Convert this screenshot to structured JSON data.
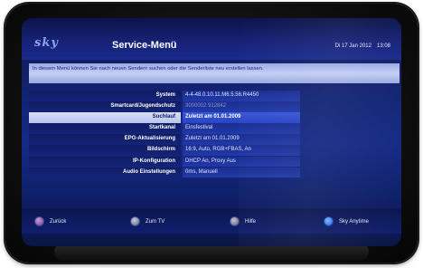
{
  "header": {
    "logo": "sky",
    "title": "Service-Menü",
    "date": "Di 17 Jan 2012",
    "time": "13:08"
  },
  "info": "In diesem Menü können Sie nach neuen Sendern suchen oder die Senderliste neu erstellen lassen.",
  "rows": [
    {
      "label": "System",
      "value": "4-4-48.0.10.11.M6.5.56.R4450"
    },
    {
      "label": "Smartcard/Jugendschutz",
      "value": "3000002 912842"
    },
    {
      "label": "Suchlauf",
      "value": "Zuletzt am 01.01.2009"
    },
    {
      "label": "Startkanal",
      "value": "Einsfestival"
    },
    {
      "label": "EPG-Aktualisierung",
      "value": "Zuletzt am 01.01.2009"
    },
    {
      "label": "Bildschirm",
      "value": "16:9, Auto, RGB+FBAS, An"
    },
    {
      "label": "IP-Konfiguration",
      "value": "DHCP An, Proxy Aus"
    },
    {
      "label": "Audio Einstellungen",
      "value": "0ms, Manuell"
    }
  ],
  "footer": {
    "back_label": "Zurück",
    "tv_label": "Zum TV",
    "help_label": "Hilfe",
    "sky_label": "Sky Anytime"
  },
  "colors": {
    "screen_bg": "#152a86",
    "selected_row": "#2943c4",
    "info_bg": "#c5cef4"
  }
}
